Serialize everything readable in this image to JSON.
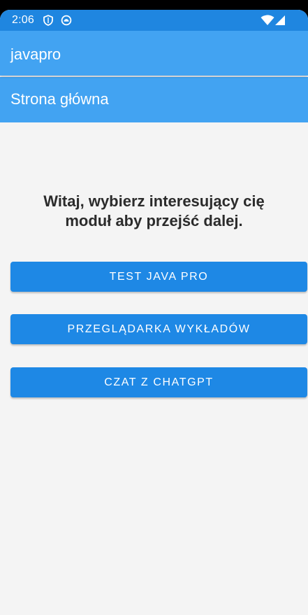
{
  "status_bar": {
    "time": "2:06",
    "background": "#1f86e0",
    "left_icons": [
      "shield-icon",
      "app-notification-icon"
    ],
    "right_icons": [
      "wifi-icon",
      "signal-icon"
    ]
  },
  "app_bar": {
    "title": "javapro",
    "background": "#42a3f2"
  },
  "sub_header": {
    "title": "Strona główna"
  },
  "main": {
    "welcome_text": "Witaj, wybierz interesujący cię moduł aby przejść dalej.",
    "buttons": [
      {
        "label": "TEST JAVA PRO"
      },
      {
        "label": "PRZEGLĄDARKA WYKŁADÓW"
      },
      {
        "label": "CZAT Z CHATGPT"
      }
    ],
    "button_color": "#1e88e5",
    "background": "#f4f4f4"
  }
}
